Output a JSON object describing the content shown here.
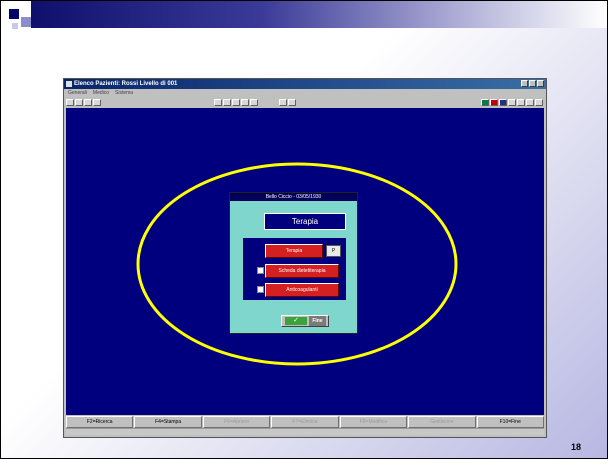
{
  "slide": {
    "page_number": "18"
  },
  "window": {
    "title": "Elenco Pazienti: Rossi Livello di 001",
    "menu": [
      "Generali",
      "Medico",
      "Sistema"
    ]
  },
  "dialog": {
    "title": "Bello Ciccio - 03/05/1930",
    "header": "Terapia",
    "buttons": {
      "terapia": "Terapia",
      "scheda": "Scheda dietetiterapia",
      "anticoagulanti": "Anticoagulanti"
    },
    "p_label": "P",
    "fine_label": "Fine"
  },
  "statusbar": {
    "keys": [
      "F2=Ricerca",
      "F4=Stampa",
      "F6=Apriere",
      "F7=Elimina",
      "F8=Modifica",
      "Gestiscine",
      "F10=Fine"
    ]
  },
  "colors": {
    "desktop": "#00007f",
    "dialog_bg": "#7fd6cc",
    "button_red": "#d42020",
    "highlight_ellipse": "#ffff00"
  }
}
